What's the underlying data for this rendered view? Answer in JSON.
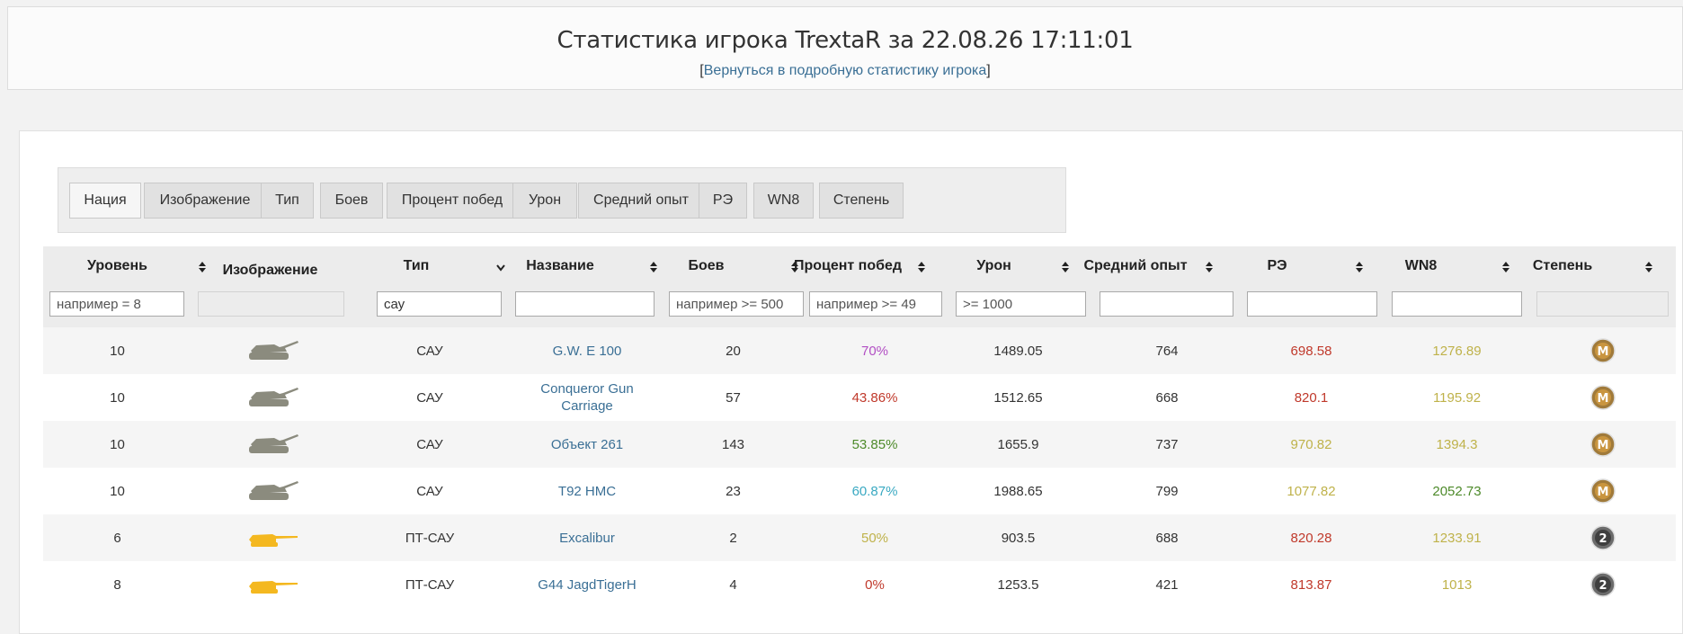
{
  "header": {
    "title": "Статистика игрока TrextaR за 22.08.26 17:11:01",
    "back_open": "[",
    "back_link": "Вернуться в подробную статистику игрока",
    "back_close": "]"
  },
  "column_toggles": [
    {
      "label": "Нация",
      "active": true
    },
    {
      "label": "Изображение",
      "active": false
    },
    {
      "label": "Тип",
      "active": false
    },
    {
      "label": "Боев",
      "active": false
    },
    {
      "label": "Процент побед",
      "active": false
    },
    {
      "label": "Урон",
      "active": false
    },
    {
      "label": "Средний опыт",
      "active": false
    },
    {
      "label": "РЭ",
      "active": false
    },
    {
      "label": "WN8",
      "active": false
    },
    {
      "label": "Степень",
      "active": false
    }
  ],
  "table": {
    "headers": [
      "Уровень",
      "Изображение",
      "Тип",
      "Название",
      "Боев",
      "Процент побед",
      "Урон",
      "Средний опыт",
      "РЭ",
      "WN8",
      "Степень"
    ],
    "filters": {
      "level": {
        "value": "",
        "placeholder": "например = 8"
      },
      "type": {
        "value": "сау",
        "placeholder": ""
      },
      "name": {
        "value": "",
        "placeholder": ""
      },
      "battles": {
        "value": "",
        "placeholder": "например >= 500"
      },
      "winrate": {
        "value": "",
        "placeholder": "например >= 49"
      },
      "damage": {
        "value": "",
        "placeholder": ">= 1000"
      },
      "xp": {
        "value": "",
        "placeholder": ""
      },
      "re": {
        "value": "",
        "placeholder": ""
      },
      "wn8": {
        "value": "",
        "placeholder": ""
      }
    },
    "rows": [
      {
        "level": "10",
        "image": "spg-grey-icon",
        "type": "САУ",
        "name": "G.W. E 100",
        "battles": "20",
        "winrate": "70%",
        "winrate_color": "#b24fc4",
        "damage": "1489.05",
        "xp": "764",
        "re": "698.58",
        "re_color": "#c0392b",
        "wn8": "1276.89",
        "wn8_color": "#bfb24a",
        "mastery": "master-medal-icon",
        "mastery_label": "M"
      },
      {
        "level": "10",
        "image": "spg-grey-icon",
        "type": "САУ",
        "name": "Conqueror Gun Carriage",
        "battles": "57",
        "winrate": "43.86%",
        "winrate_color": "#c0392b",
        "damage": "1512.65",
        "xp": "668",
        "re": "820.1",
        "re_color": "#c0392b",
        "wn8": "1195.92",
        "wn8_color": "#bfb24a",
        "mastery": "master-medal-icon",
        "mastery_label": "M"
      },
      {
        "level": "10",
        "image": "spg-grey-icon",
        "type": "САУ",
        "name": "Объект 261",
        "battles": "143",
        "winrate": "53.85%",
        "winrate_color": "#4d8a2a",
        "damage": "1655.9",
        "xp": "737",
        "re": "970.82",
        "re_color": "#bfb24a",
        "wn8": "1394.3",
        "wn8_color": "#bfb24a",
        "mastery": "master-medal-icon",
        "mastery_label": "M"
      },
      {
        "level": "10",
        "image": "spg-grey-icon",
        "type": "САУ",
        "name": "T92 HMC",
        "battles": "23",
        "winrate": "60.87%",
        "winrate_color": "#3aa9c2",
        "damage": "1988.65",
        "xp": "799",
        "re": "1077.82",
        "re_color": "#bfb24a",
        "wn8": "2052.73",
        "wn8_color": "#4d8a2a",
        "mastery": "master-medal-icon",
        "mastery_label": "M"
      },
      {
        "level": "6",
        "image": "td-gold-icon",
        "type": "ПТ-САУ",
        "name": "Excalibur",
        "battles": "2",
        "winrate": "50%",
        "winrate_color": "#bfb24a",
        "damage": "903.5",
        "xp": "688",
        "re": "820.28",
        "re_color": "#c0392b",
        "wn8": "1233.91",
        "wn8_color": "#bfb24a",
        "mastery": "second-class-medal-icon",
        "mastery_label": "2"
      },
      {
        "level": "8",
        "image": "td-gold-icon",
        "type": "ПТ-САУ",
        "name": "G44 JagdTigerH",
        "battles": "4",
        "winrate": "0%",
        "winrate_color": "#c0392b",
        "damage": "1253.5",
        "xp": "421",
        "re": "813.87",
        "re_color": "#c0392b",
        "wn8": "1013",
        "wn8_color": "#bfb24a",
        "mastery": "second-class-medal-icon",
        "mastery_label": "2"
      }
    ]
  }
}
